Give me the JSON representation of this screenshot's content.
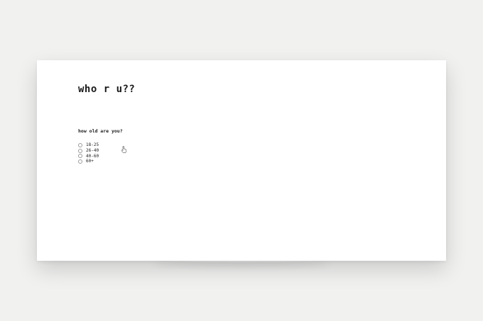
{
  "page": {
    "title": "who r u??"
  },
  "form": {
    "question": "how old are you?",
    "options": [
      {
        "label": "18-25",
        "selected": false
      },
      {
        "label": "26-40",
        "selected": false
      },
      {
        "label": "40-60",
        "selected": false
      },
      {
        "label": "60+",
        "selected": false
      }
    ]
  },
  "icons": {
    "cursor": "hand-pointer-icon"
  },
  "colors": {
    "background": "#f1f1f0",
    "card": "#ffffff",
    "text": "#1a1a1a"
  }
}
